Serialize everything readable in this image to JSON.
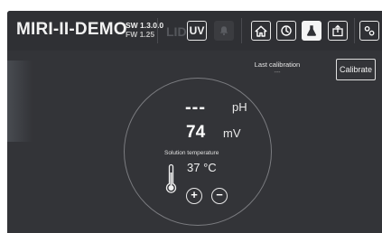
{
  "header": {
    "brand": "MIRI-II-DEMO",
    "sw_version": "SW 1.3.0.0",
    "fw_version": "FW 1.25",
    "lid_label": "LID",
    "uv_label": "UV"
  },
  "toolbar": {
    "icons": [
      "bell-icon",
      "home-icon",
      "power-icon",
      "flask-icon",
      "export-icon",
      "settings-icon"
    ],
    "active": "flask-icon"
  },
  "calibration": {
    "last_label": "Last calibration",
    "last_value": "---",
    "button_label": "Calibrate"
  },
  "measurement": {
    "ph_value": "---",
    "ph_unit": "pH",
    "mv_value": "74",
    "mv_unit": "mV",
    "temp_label": "Solution temperature",
    "temp_value": "37 °C",
    "plus_label": "+",
    "minus_label": "−"
  },
  "colors": {
    "background": "#333438",
    "header": "#2f3034",
    "foreground": "#ffffff",
    "ring": "#7b7c80"
  }
}
